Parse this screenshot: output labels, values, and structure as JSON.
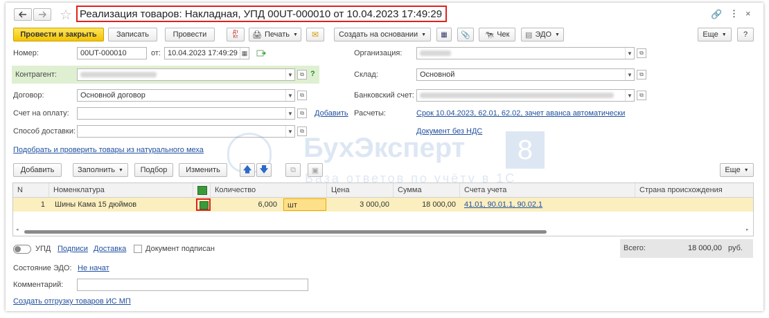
{
  "header": {
    "title": "Реализация товаров: Накладная, УПД 00UT-000010 от 10.04.2023 17:49:29",
    "highlight_color": "#e0201c"
  },
  "toolbar": {
    "post_close": "Провести и закрыть",
    "save": "Записать",
    "post": "Провести",
    "print": "Печать",
    "create_based": "Создать на основании",
    "check": "Чек",
    "edo": "ЭДО",
    "more": "Еще",
    "help": "?"
  },
  "form": {
    "number_label": "Номер:",
    "number_value": "00UT-000010",
    "date_label": "от:",
    "date_value": "10.04.2023 17:49:29",
    "contractor_label": "Контрагент:",
    "contract_label": "Договор:",
    "contract_value": "Основной договор",
    "invoice_label": "Счет на оплату:",
    "add_link": "Добавить",
    "delivery_label": "Способ доставки:",
    "org_label": "Организация:",
    "warehouse_label": "Склад:",
    "warehouse_value": "Основной",
    "bank_label": "Банковский счет:",
    "settlements_label": "Расчеты:",
    "settlements_value": "Срок 10.04.2023, 62.01, 62.02, зачет аванса автоматически",
    "vat_link": "Документ без НДС",
    "fur_link": "Подобрать и проверить товары из натурального меха"
  },
  "table_toolbar": {
    "add": "Добавить",
    "fill": "Заполнить",
    "pick": "Подбор",
    "change": "Изменить",
    "more": "Еще"
  },
  "table": {
    "columns": [
      "N",
      "Номенклатура",
      "Количество",
      "Цена",
      "Сумма",
      "Счета учета",
      "Страна происхождения"
    ],
    "rows": [
      {
        "n": "1",
        "item": "Шины Кама 15 дюймов",
        "qty": "6,000",
        "unit": "шт",
        "price": "3 000,00",
        "sum": "18 000,00",
        "accounts": "41.01, 90.01.1, 90.02.1",
        "country": ""
      }
    ]
  },
  "footer": {
    "upd": "УПД",
    "signatures": "Подписи",
    "delivery": "Доставка",
    "signed": "Документ подписан",
    "total_label": "Всего:",
    "total_value": "18 000,00",
    "currency": "руб.",
    "edo_state_label": "Состояние ЭДО:",
    "edo_state_value": "Не начат",
    "comment_label": "Комментарий:",
    "ship_link": "Создать отгрузку товаров ИС МП"
  },
  "watermark": {
    "brand": "БухЭксперт",
    "number": "8",
    "tagline": "База ответов по учёту в 1С"
  }
}
